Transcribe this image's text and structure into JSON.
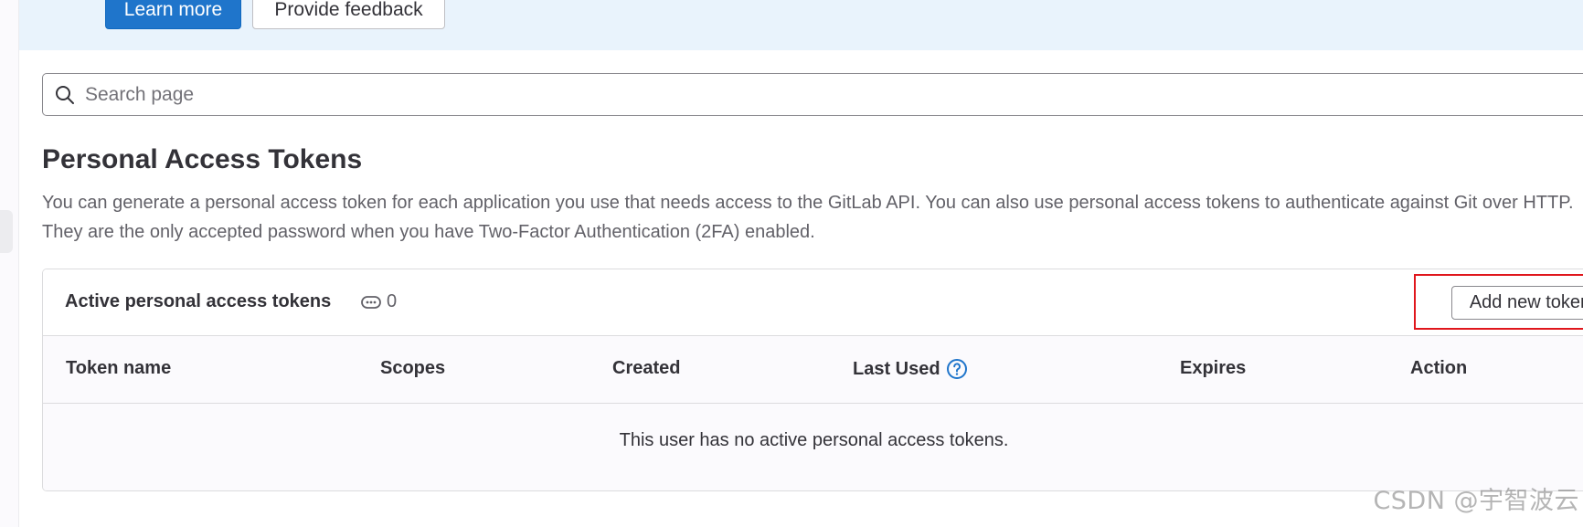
{
  "banner": {
    "learn_more_label": "Learn more",
    "feedback_label": "Provide feedback"
  },
  "search": {
    "placeholder": "Search page",
    "value": ""
  },
  "page": {
    "title": "Personal Access Tokens",
    "description": "You can generate a personal access token for each application you use that needs access to the GitLab API. You can also use personal access tokens to authenticate against Git over HTTP. They are the only accepted password when you have Two-Factor Authentication (2FA) enabled."
  },
  "tokens_card": {
    "title": "Active personal access tokens",
    "count": "0",
    "add_button_label": "Add new token",
    "columns": [
      "Token name",
      "Scopes",
      "Created",
      "Last Used",
      "Expires",
      "Action"
    ],
    "empty_message": "This user has no active personal access tokens."
  },
  "watermark": "CSDN @宇智波云",
  "icons": {
    "search": "search-icon",
    "token": "token-icon",
    "help": "question-circle-icon"
  },
  "colors": {
    "primary": "#1f75cb",
    "banner_bg": "#e9f3fc",
    "highlight": "#e0161c",
    "help_icon": "#1f75cb"
  }
}
